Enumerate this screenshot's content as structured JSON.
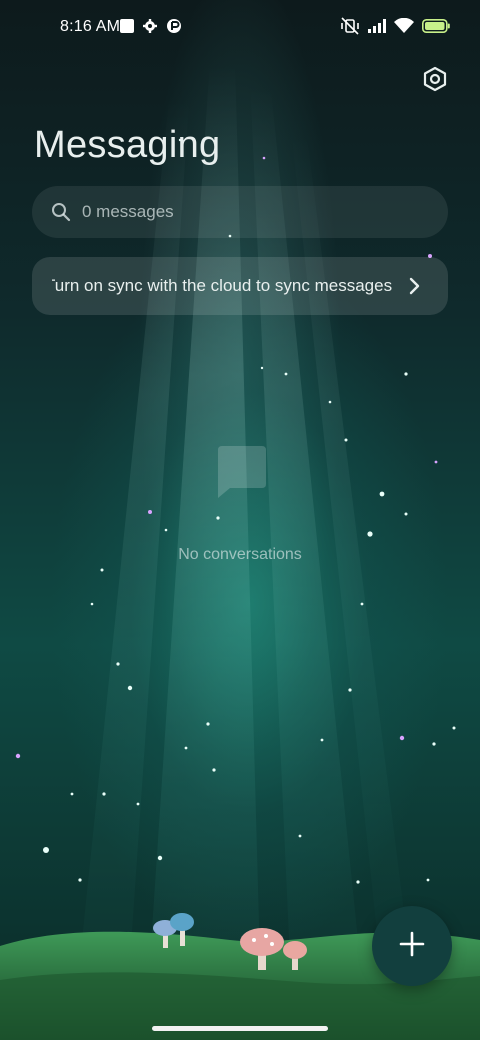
{
  "status_bar": {
    "time": "8:16 AM"
  },
  "header": {
    "title": "Messaging",
    "settings_icon": "settings-hexagon-icon"
  },
  "search": {
    "placeholder": "0 messages",
    "icon": "search-icon"
  },
  "sync_banner": {
    "text": "Turn on sync with the cloud to sync messages",
    "icon": "chevron-right-icon"
  },
  "empty_state": {
    "icon": "message-bubble-icon",
    "text": "No conversations"
  },
  "fab": {
    "icon": "plus-icon"
  },
  "colors": {
    "fab_background": "#123f3e",
    "accent_teal": "#2aa08c"
  }
}
